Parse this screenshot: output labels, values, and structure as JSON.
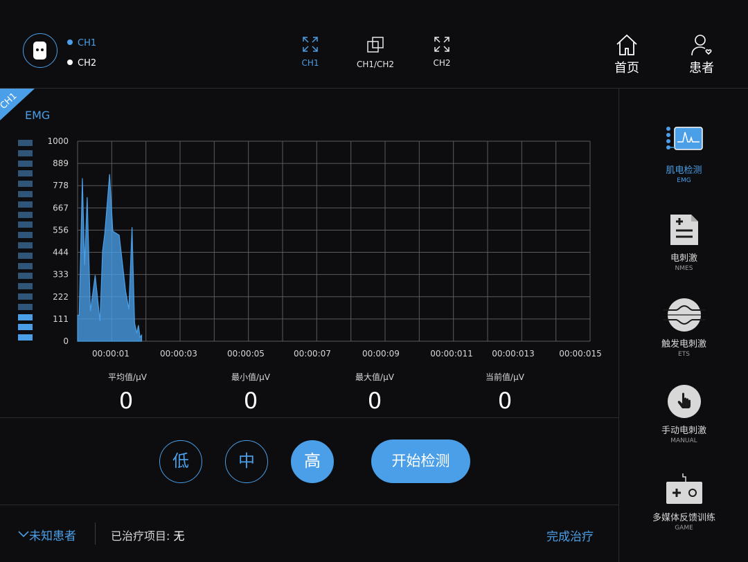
{
  "header": {
    "channels": [
      {
        "label": "CH1",
        "color": "#4a9fe8"
      },
      {
        "label": "CH2",
        "color": "#ffffff"
      }
    ],
    "view_modes": [
      {
        "label": "CH1",
        "icon": "expand-icon",
        "active": true
      },
      {
        "label": "CH1/CH2",
        "icon": "dual-window-icon",
        "active": false
      },
      {
        "label": "CH2",
        "icon": "expand-icon",
        "active": false
      }
    ],
    "nav": [
      {
        "label": "首页",
        "icon": "home-icon"
      },
      {
        "label": "患者",
        "icon": "patient-icon"
      }
    ]
  },
  "panel": {
    "channel_tag": "CH1",
    "title": "EMG",
    "level_meter": {
      "segments": 20,
      "active": 3
    }
  },
  "chart_data": {
    "type": "area",
    "y_ticks": [
      "1000",
      "889",
      "778",
      "667",
      "556",
      "444",
      "333",
      "222",
      "111",
      "0"
    ],
    "x_ticks": [
      "00:00:01",
      "00:00:03",
      "00:00:05",
      "00:00:07",
      "00:00:09",
      "00:00:011",
      "00:00:013",
      "00:00:015"
    ],
    "ylim": [
      0,
      1000
    ],
    "xlim": [
      0,
      16
    ],
    "grid": true,
    "series": [
      {
        "color": "#4a9fe8",
        "x": [
          0.0,
          0.05,
          0.15,
          0.22,
          0.3,
          0.4,
          0.55,
          0.7,
          0.78,
          0.85,
          1.0,
          1.1,
          1.3,
          1.5,
          1.6,
          1.7,
          1.78,
          1.85,
          1.9,
          1.95,
          2.0
        ],
        "y": [
          130,
          130,
          815,
          380,
          720,
          150,
          330,
          100,
          450,
          540,
          835,
          550,
          530,
          250,
          160,
          570,
          90,
          40,
          80,
          20,
          30
        ]
      }
    ]
  },
  "stats": [
    {
      "label": "平均值/μV",
      "value": "0"
    },
    {
      "label": "最小值/μV",
      "value": "0"
    },
    {
      "label": "最大值/μV",
      "value": "0"
    },
    {
      "label": "当前值/μV",
      "value": "0"
    }
  ],
  "controls": {
    "levels": [
      {
        "label": "低",
        "active": false
      },
      {
        "label": "中",
        "active": false
      },
      {
        "label": "高",
        "active": true
      }
    ],
    "start_label": "开始检测"
  },
  "footer": {
    "patient": "未知患者",
    "treated_label": "已治疗项目:",
    "treated_value": "无",
    "finish_label": "完成治疗"
  },
  "sidebar": [
    {
      "title": "肌电检测",
      "sub": "EMG",
      "icon": "emg-icon",
      "active": true
    },
    {
      "title": "电刺激",
      "sub": "NMES",
      "icon": "nmes-document-icon",
      "active": false
    },
    {
      "title": "触发电刺激",
      "sub": "ETS",
      "icon": "trigger-wave-icon",
      "active": false
    },
    {
      "title": "手动电刺激",
      "sub": "MANUAL",
      "icon": "hand-pointer-icon",
      "active": false
    },
    {
      "title": "多媒体反馈训练",
      "sub": "GAME",
      "icon": "gamepad-icon",
      "active": false
    }
  ],
  "colors": {
    "accent": "#4a9fe8",
    "background": "#0d0d0f",
    "grid": "#5a5a60"
  }
}
